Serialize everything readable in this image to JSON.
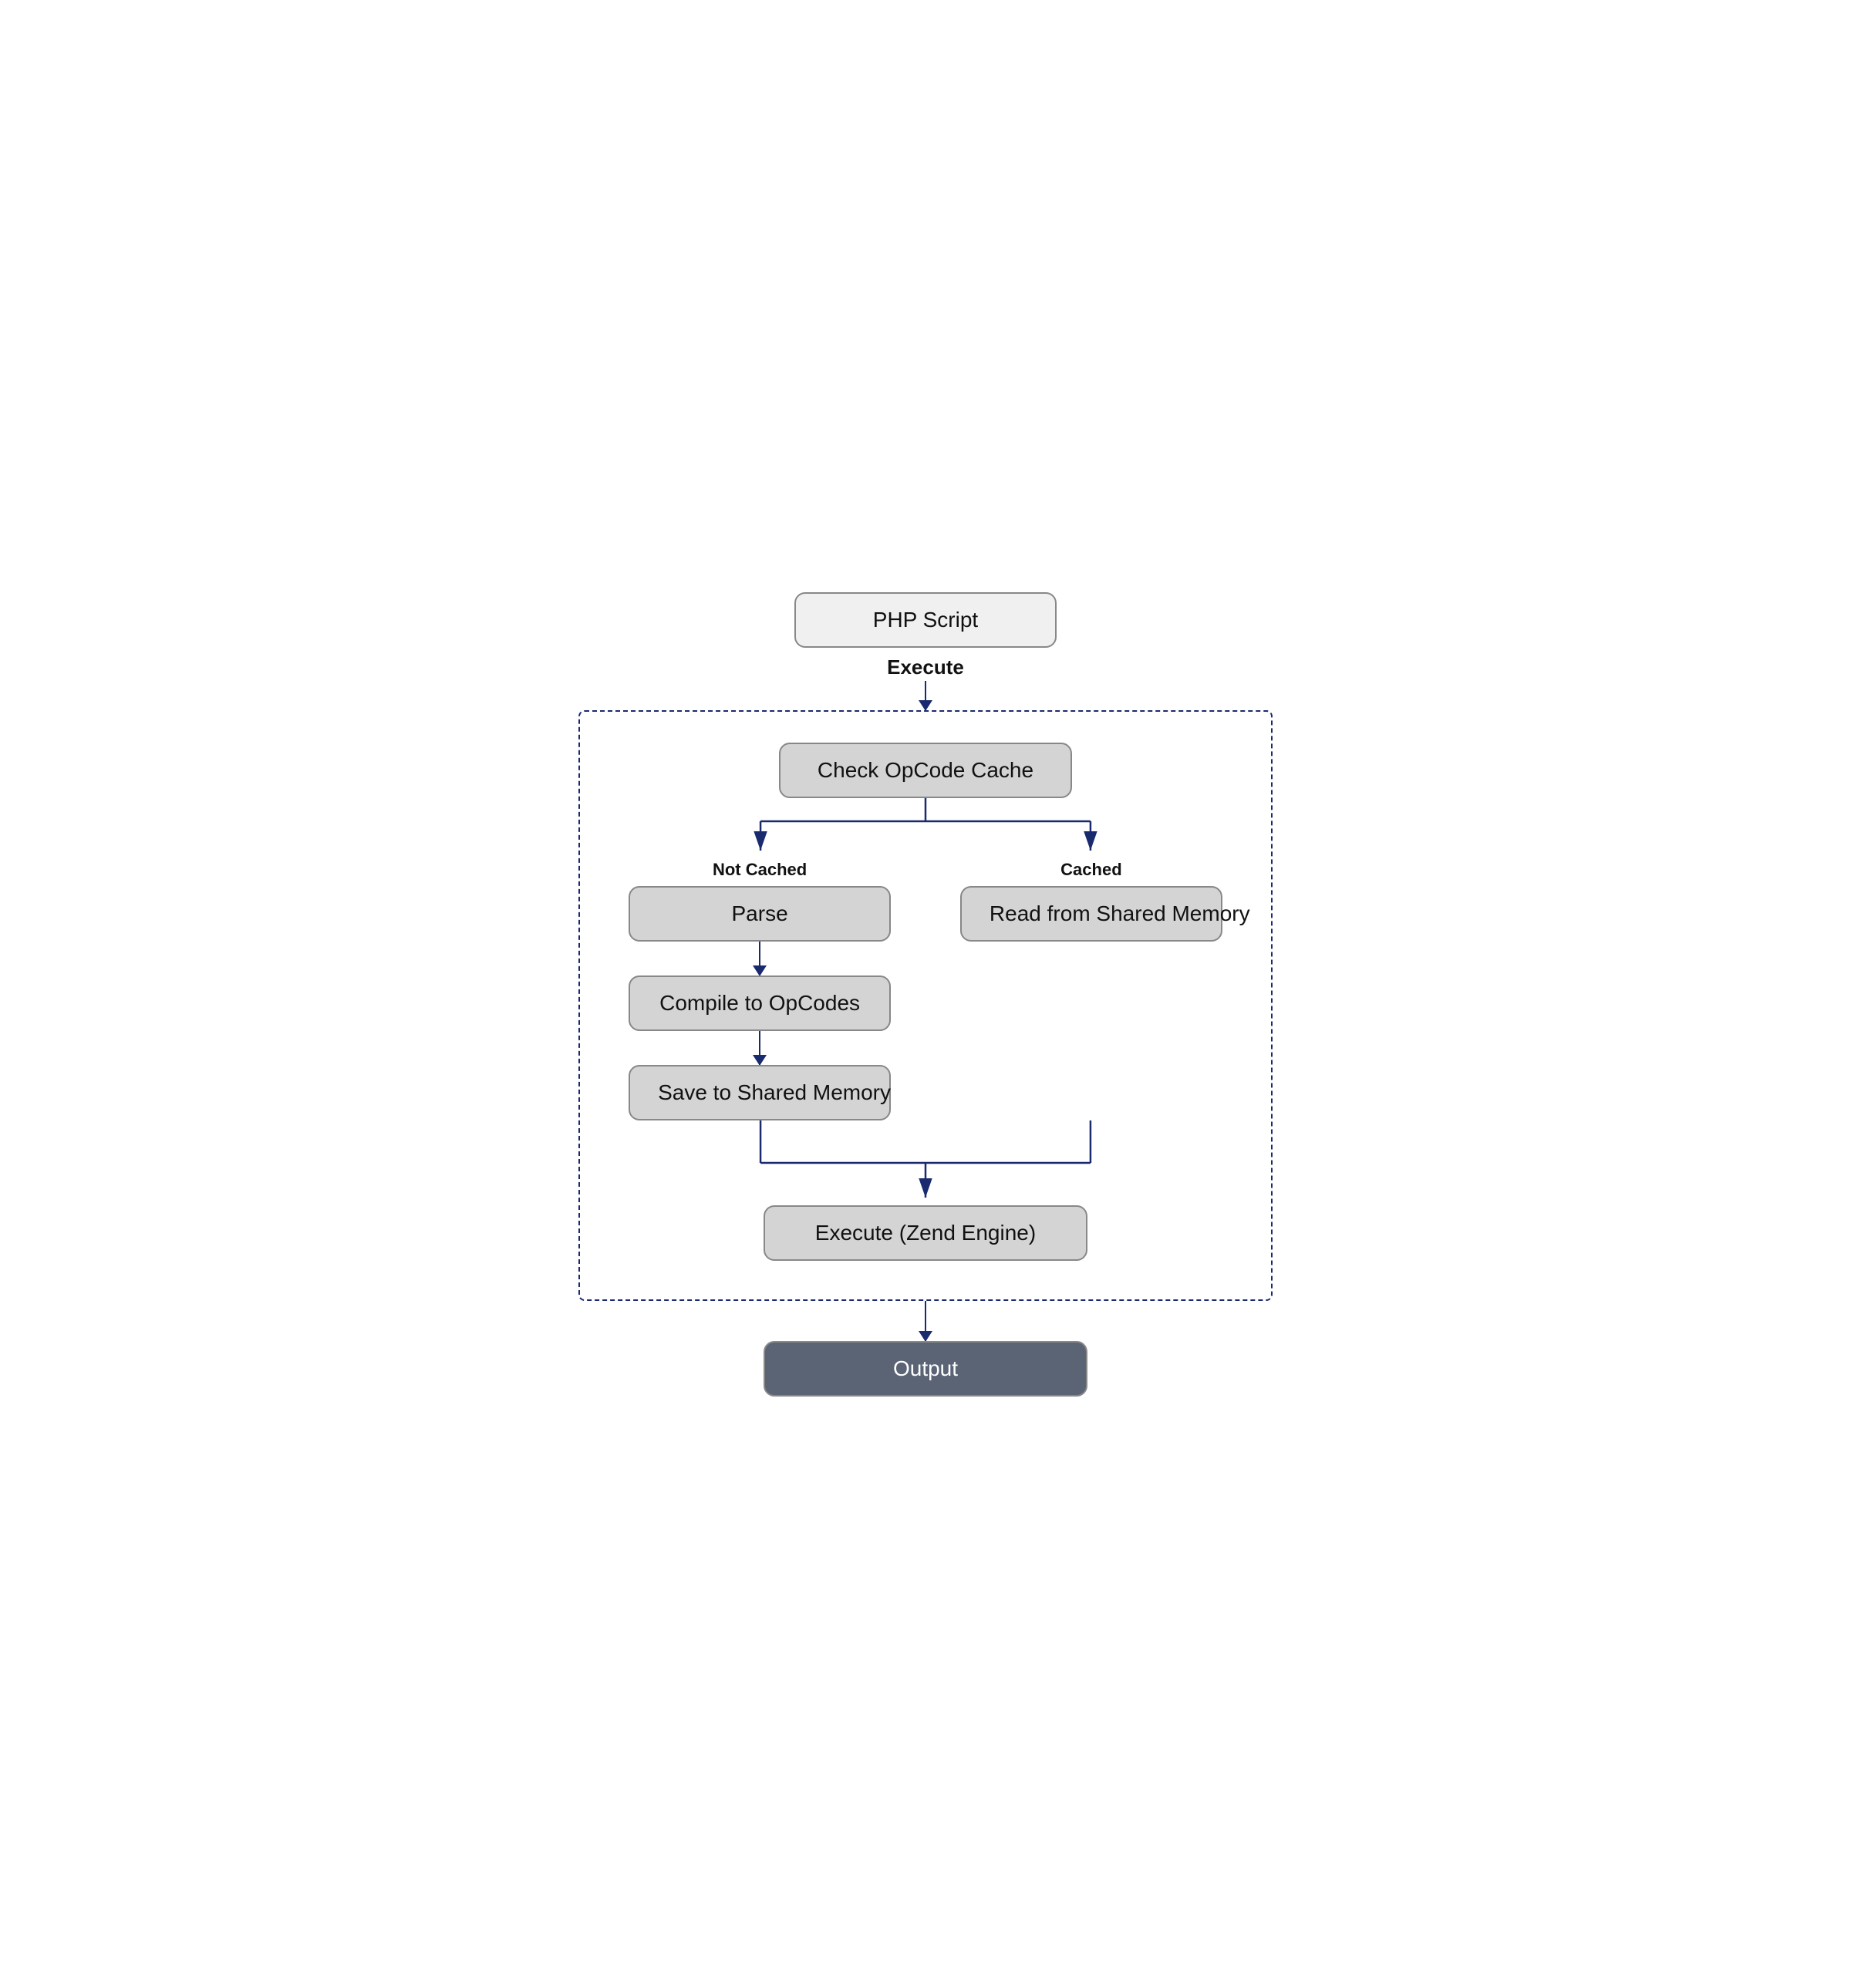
{
  "nodes": {
    "php_script": "PHP Script",
    "execute_label": "Execute",
    "check_opcache": "Check OpCode Cache",
    "not_cached_label": "Not Cached",
    "cached_label": "Cached",
    "parse": "Parse",
    "read_shared": "Read from Shared Memory",
    "compile": "Compile to OpCodes",
    "save_shared": "Save to Shared Memory",
    "execute_zend": "Execute (Zend Engine)",
    "output": "Output"
  },
  "colors": {
    "node_bg": "#d4d4d4",
    "node_light_bg": "#f0f0f0",
    "node_dark_bg": "#5a6475",
    "border": "#888888",
    "arrow": "#1a2a6e",
    "dashed_border": "#1a2a6e",
    "text": "#111111",
    "text_white": "#ffffff"
  }
}
